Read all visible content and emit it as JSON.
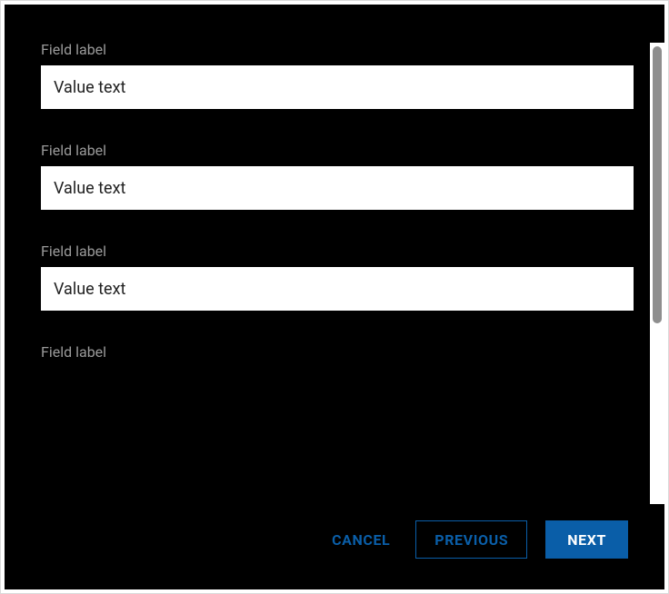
{
  "fields": [
    {
      "label": "Field label",
      "value": "Value text"
    },
    {
      "label": "Field label",
      "value": "Value text"
    },
    {
      "label": "Field label",
      "value": "Value text"
    },
    {
      "label": "Field label",
      "value": ""
    }
  ],
  "footer": {
    "cancel_label": "Cancel",
    "previous_label": "Previous",
    "next_label": "Next"
  },
  "colors": {
    "accent": "#0a5ea8",
    "panel_bg": "#000000",
    "label_text": "#9a9a9a"
  }
}
